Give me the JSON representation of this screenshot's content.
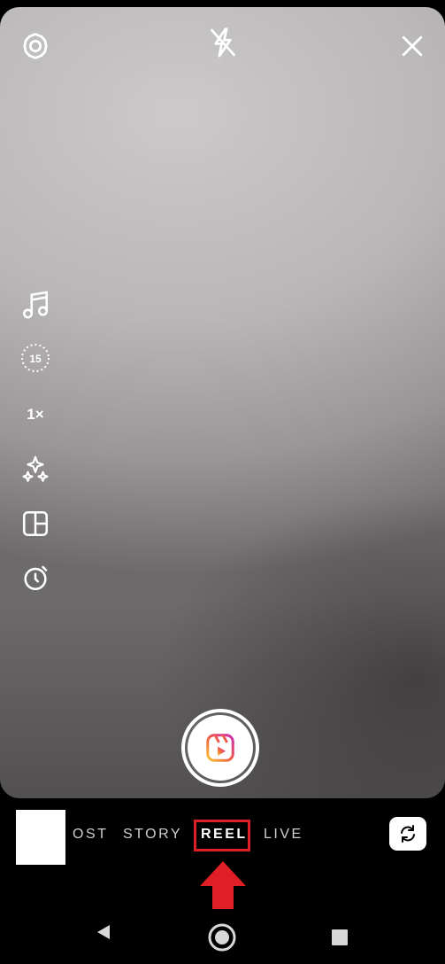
{
  "top_bar": {
    "settings_icon": "gear-icon",
    "flash_icon": "flash-off-icon",
    "close_icon": "close-icon"
  },
  "left_tools": [
    {
      "name": "audio",
      "icon": "music-note-icon"
    },
    {
      "name": "length",
      "icon": "timer-15-icon",
      "value": "15"
    },
    {
      "name": "speed",
      "label": "1×"
    },
    {
      "name": "effects",
      "icon": "sparkles-icon"
    },
    {
      "name": "layout",
      "icon": "layout-icon"
    },
    {
      "name": "timer",
      "icon": "countdown-icon"
    }
  ],
  "modes": {
    "post": "OST",
    "story": "STORY",
    "reel": "REEL",
    "live": "LIVE",
    "active": "REEL"
  },
  "colors": {
    "highlight": "#e01e25",
    "reels_gradient_start": "#f9c530",
    "reels_gradient_end": "#c92bb0"
  },
  "nav": {
    "back_icon": "back-triangle-icon",
    "home_icon": "home-circle-icon",
    "recents_icon": "recents-square-icon"
  }
}
